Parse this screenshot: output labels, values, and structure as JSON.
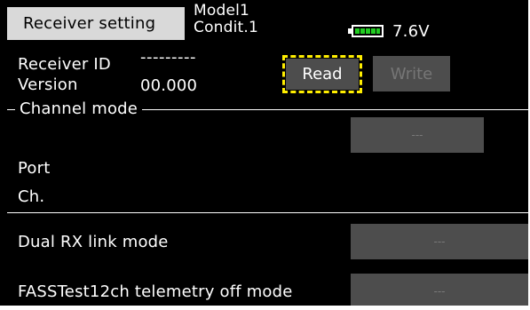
{
  "header": {
    "title": "Receiver setting",
    "model": "Model1",
    "condition": "Condit.1",
    "battery_icon": "battery-icon",
    "battery_color": "#22cc22",
    "voltage": "7.6V"
  },
  "receiver": {
    "id_label": "Receiver ID",
    "id_value": "---------",
    "version_label": "Version",
    "version_value": "00.000",
    "read_label": "Read",
    "write_label": "Write",
    "focus_color": "#ffee00"
  },
  "channel_mode": {
    "section_label": "Channel mode",
    "value": "---",
    "port_label": "Port",
    "ch_label": "Ch."
  },
  "dual_rx": {
    "label": "Dual RX link mode",
    "value": "---"
  },
  "fasstest": {
    "label": "FASSTest12ch telemetry off mode",
    "value": "---"
  }
}
